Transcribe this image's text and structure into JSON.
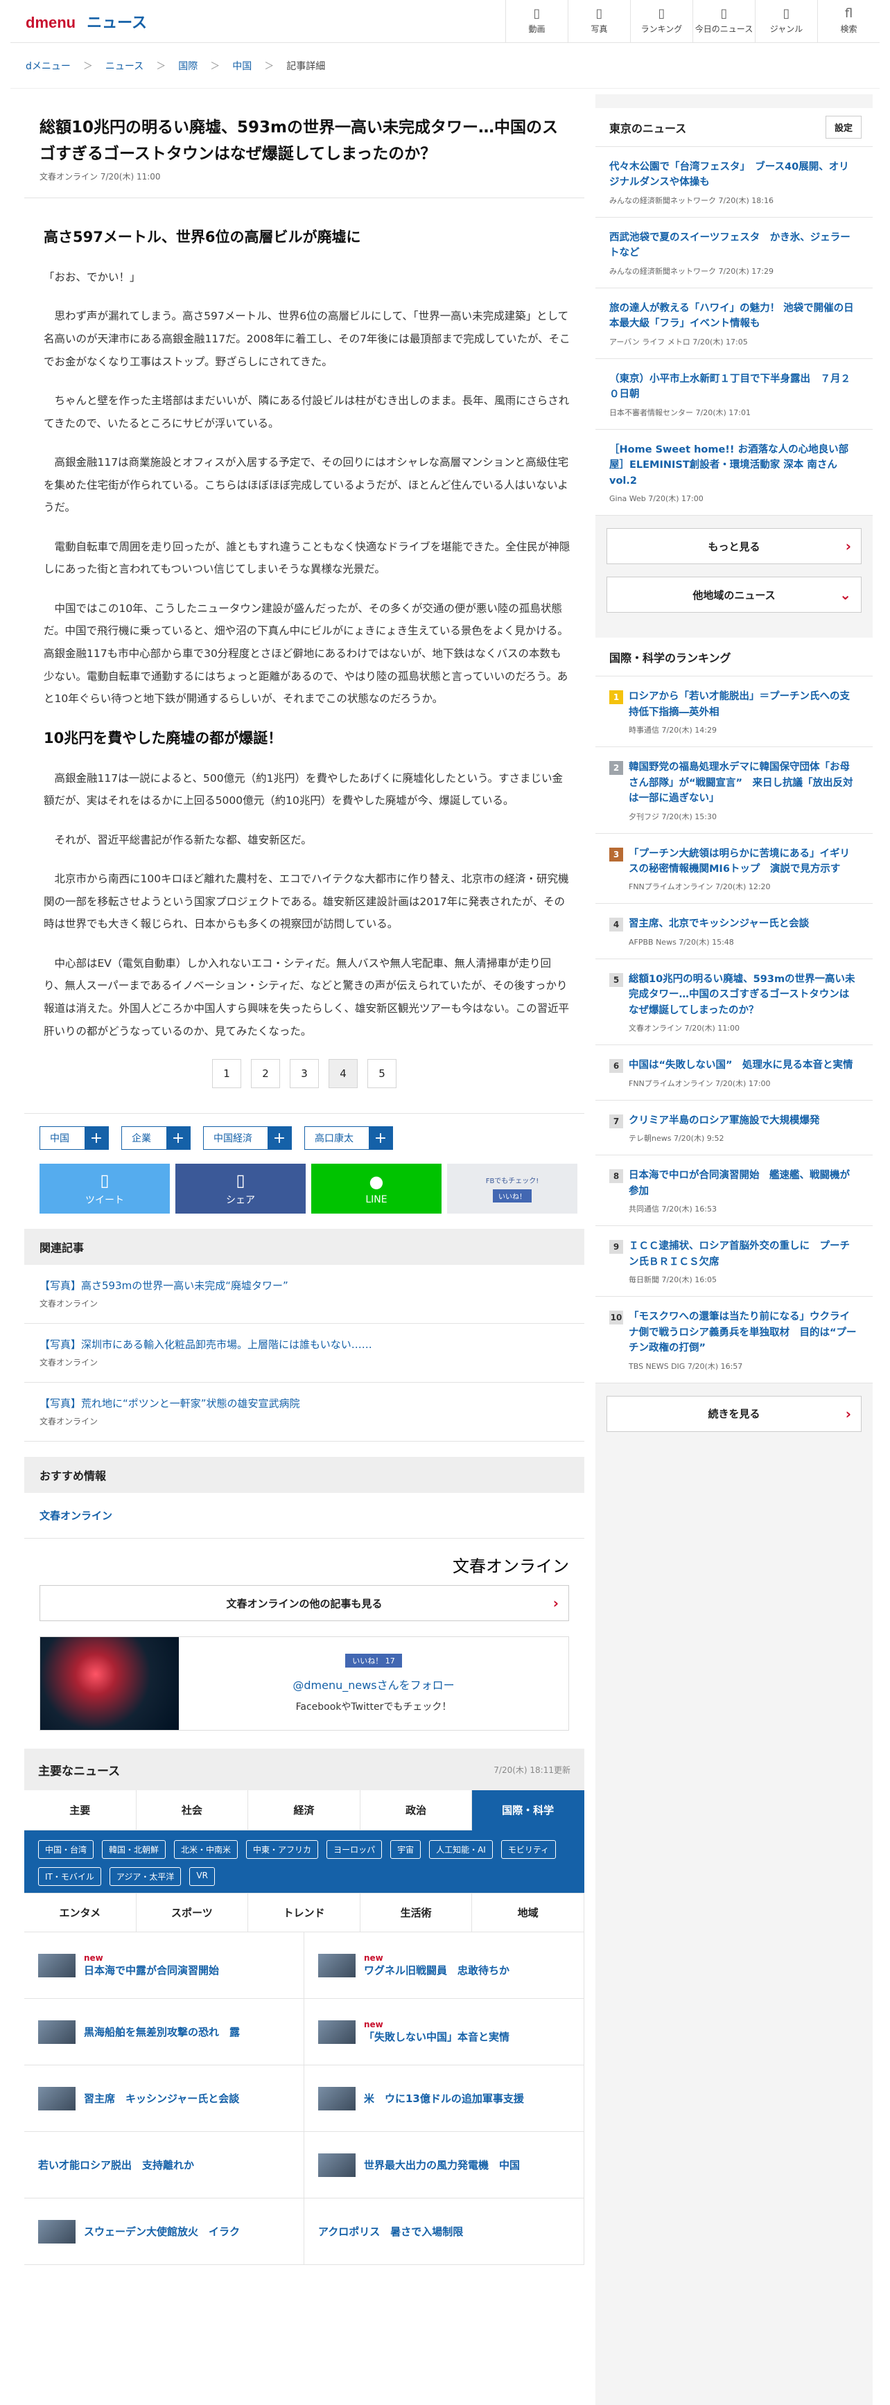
{
  "header": {
    "logo_d": "dmenu",
    "logo_n": "ニュース",
    "nav": [
      {
        "icon": "video-icon",
        "glyph": "▯",
        "label": "動画"
      },
      {
        "icon": "photo-icon",
        "glyph": "▯",
        "label": "写真"
      },
      {
        "icon": "ranking-icon",
        "glyph": "▯",
        "label": "ランキング"
      },
      {
        "icon": "today-icon",
        "glyph": "▯",
        "label": "今日のニュース"
      },
      {
        "icon": "genre-icon",
        "glyph": "▯",
        "label": "ジャンル"
      },
      {
        "icon": "search-icon",
        "glyph": "fl",
        "label": "検索"
      }
    ]
  },
  "breadcrumb": [
    "dメニュー",
    "ニュース",
    "国際",
    "中国",
    "記事詳細"
  ],
  "article": {
    "title": "総額10兆円の明るい廃墟、593mの世界一高い未完成タワー…中国のスゴすぎるゴーストタウンはなぜ爆誕してしまったのか？",
    "meta": "文春オンライン 7/20(木) 11:00",
    "h1": "高さ597メートル、世界6位の高層ビルが廃墟に",
    "p1": "「おお、でかい！」",
    "p2": "　思わず声が漏れてしまう。高さ597メートル、世界6位の高層ビルにして、「世界一高い未完成建築」として名高いのが天津市にある高銀金融117だ。2008年に着工し、その7年後には最頂部まで完成していたが、そこでお金がなくなり工事はストップ。野ざらしにされてきた。",
    "p3": "　ちゃんと壁を作った主塔部はまだいいが、隣にある付設ビルは柱がむき出しのまま。長年、風雨にさらされてきたので、いたるところにサビが浮いている。",
    "p4": "　高銀金融117は商業施設とオフィスが入居する予定で、その回りにはオシャレな高層マンションと高級住宅を集めた住宅街が作られている。こちらはほぼほぼ完成しているようだが、ほとんど住んでいる人はいないようだ。",
    "p5": "　電動自転車で周囲を走り回ったが、誰ともすれ違うこともなく快適なドライブを堪能できた。全住民が神隠しにあった街と言われてもついつい信じてしまいそうな異様な光景だ。",
    "p6": "　中国ではこの10年、こうしたニュータウン建設が盛んだったが、その多くが交通の便が悪い陸の孤島状態だ。中国で飛行機に乗っていると、畑や沼の下真ん中にビルがにょきにょき生えている景色をよく見かける。高銀金融117も市中心部から車で30分程度とさほど僻地にあるわけではないが、地下鉄はなくバスの本数も少ない。電動自転車で通勤するにはちょっと距離があるので、やはり陸の孤島状態と言っていいのだろう。あと10年ぐらい待つと地下鉄が開通するらしいが、それまでこの状態なのだろうか。",
    "h2": "10兆円を費やした廃墟の都が爆誕！",
    "p7": "　高銀金融117は一説によると、500億元（約1兆円）を費やしたあげくに廃墟化したという。すさまじい金額だが、実はそれをはるかに上回る5000億元（約10兆円）を費やした廃墟が今、爆誕している。",
    "p8": "　それが、習近平総書記が作る新たな都、雄安新区だ。",
    "p9": "　北京市から南西に100キロほど離れた農村を、エコでハイテクな大都市に作り替え、北京市の経済・研究機関の一部を移転させようという国家プロジェクトである。雄安新区建設計画は2017年に発表されたが、その時は世界でも大きく報じられ、日本からも多くの視察団が訪問している。",
    "p10": "　中心部はEV（電気自動車）しか入れないエコ・シティだ。無人バスや無人宅配車、無人清掃車が走り回り、無人スーパーまであるイノベーション・シティだ、などと驚きの声が伝えられていたが、その後すっかり報道は消えた。外国人どころか中国人すら興味を失ったらしく、雄安新区観光ツアーも今はない。この習近平肝いりの都がどうなっているのか、見てみたくなった。",
    "pages": [
      "1",
      "2",
      "3",
      "4",
      "5"
    ]
  },
  "tags": [
    "中国",
    "企業",
    "中国経済",
    "高口康太"
  ],
  "share": {
    "tw": "ツイート",
    "fb": "シェア",
    "ln": "LINE",
    "fbc": "FBでもチェック!",
    "fbc_like": "いいね！"
  },
  "related": {
    "title": "関連記事",
    "items": [
      {
        "t": "【写真】高さ593mの世界一高い未完成“廃墟タワー”",
        "s": "文春オンライン"
      },
      {
        "t": "【写真】深圳市にある輸入化粧品卸売市場。上層階には誰もいない……",
        "s": "文春オンライン"
      },
      {
        "t": "【写真】荒れ地に“ポツンと一軒家”状態の雄安宣武病院",
        "s": "文春オンライン"
      }
    ]
  },
  "recommend": {
    "title": "おすすめ情報",
    "source": "文春オンライン",
    "logo": "文春オンライン",
    "more": "文春オンラインの他の記事も見る",
    "like": "いいね！ 17",
    "account": "@dmenu_newsさんをフォロー",
    "sub": "FacebookやTwitterでもチェック！"
  },
  "main_news": {
    "title": "主要なニュース",
    "ts": "7/20(木) 18:11更新",
    "tabs": [
      "主要",
      "社会",
      "経済",
      "政治",
      "国際・科学"
    ],
    "subcats": [
      "中国・台湾",
      "韓国・北朝鮮",
      "北米・中南米",
      "中東・アフリカ",
      "ヨーロッパ",
      "宇宙",
      "人工知能・AI",
      "モビリティ",
      "IT・モバイル",
      "アジア・太平洋",
      "VR"
    ],
    "tabs2": [
      "エンタメ",
      "スポーツ",
      "トレンド",
      "生活術",
      "地域"
    ],
    "items": [
      {
        "t": "日本海で中露が合同演習開始",
        "new": "new"
      },
      {
        "t": "ワグネル旧戦闘員　忠敢待ちか",
        "new": "new"
      },
      {
        "t": "黒海船舶を無差別攻撃の恐れ　露",
        "new": ""
      },
      {
        "t": "「失敗しない中国」本音と実情",
        "new": "new"
      },
      {
        "t": "習主席　キッシンジャー氏と会談",
        "new": ""
      },
      {
        "t": "米　ウに13億ドルの追加軍事支援",
        "new": ""
      },
      {
        "t": "若い才能ロシア脱出　支持離れか",
        "new": ""
      },
      {
        "t": "世界最大出力の風力発電機　中国",
        "new": ""
      },
      {
        "t": "スウェーデン大使館放火　イラク",
        "new": ""
      },
      {
        "t": "アクロポリス　暑さで入場制限",
        "new": ""
      }
    ]
  },
  "sidebar": {
    "tokyo_title": "東京のニュース",
    "setting": "設定",
    "tokyo": [
      {
        "t": "代々木公園で「台湾フェスタ」　ブース40展開、オリジナルダンスや体操も",
        "s": "みんなの経済新聞ネットワーク 7/20(木) 18:16"
      },
      {
        "t": "西武池袋で夏のスイーツフェスタ　かき氷、ジェラートなど",
        "s": "みんなの経済新聞ネットワーク 7/20(木) 17:29"
      },
      {
        "t": "旅の達人が教える「ハワイ」の魅力！ 池袋で開催の日本最大級「フラ」イベント情報も",
        "s": "アーバン ライフ メトロ 7/20(木) 17:05"
      },
      {
        "t": "（東京）小平市上水新町１丁目で下半身露出　７月２０日朝",
        "s": "日本不審者情報センター 7/20(木) 17:01"
      },
      {
        "t": "［Home Sweet home!! お酒落な人の心地良い部屋］ELEMINIST創設者・環境活動家 深本 南さん vol.2",
        "s": "Gina Web 7/20(木) 17:00"
      }
    ],
    "more": "もっと見る",
    "other": "他地域のニュース",
    "rank_title": "国際・科学のランキング",
    "ranking": [
      {
        "n": "1",
        "t": "ロシアから「若い才能脱出」＝プーチン氏への支持低下指摘―英外相",
        "s": "時事通信 7/20(木) 14:29"
      },
      {
        "n": "2",
        "t": "韓国野党の福島処理水デマに韓国保守団体「お母さん部隊」が“戦闘宣言”　来日し抗議「放出反対は一部に過ぎない」",
        "s": "夕刊フジ 7/20(木) 15:30"
      },
      {
        "n": "3",
        "t": "「プーチン大統領は明らかに苦境にある」イギリスの秘密情報機関MI6トップ　演説で見方示す",
        "s": "FNNプライムオンライン 7/20(木) 12:20"
      },
      {
        "n": "4",
        "t": "習主席、北京でキッシンジャー氏と会談",
        "s": "AFPBB News 7/20(木) 15:48"
      },
      {
        "n": "5",
        "t": "総額10兆円の明るい廃墟、593mの世界一高い未完成タワー…中国のスゴすぎるゴーストタウンはなぜ爆誕してしまったのか？",
        "s": "文春オンライン 7/20(木) 11:00"
      },
      {
        "n": "6",
        "t": "中国は“失敗しない国”　処理水に見る本音と実情",
        "s": "FNNプライムオンライン 7/20(木) 17:00"
      },
      {
        "n": "7",
        "t": "クリミア半島のロシア軍施設で大規模爆発",
        "s": "テレ朝news 7/20(木) 9:52"
      },
      {
        "n": "8",
        "t": "日本海で中ロが合同演習開始　艦速艦、戦闘機が参加",
        "s": "共同通信 7/20(木) 16:53"
      },
      {
        "n": "9",
        "t": "ＩＣＣ逮捕状、ロシア首脳外交の重しに　プーチン氏ＢＲＩＣＳ欠席",
        "s": "毎日新聞 7/20(木) 16:05"
      },
      {
        "n": "10",
        "t": "「モスクワへの還筆は当たり前になる」ウクライナ側で戦うロシア義勇兵を単独取材　目的は“プーチン政権の打倒”",
        "s": "TBS NEWS DIG 7/20(木) 16:57"
      }
    ],
    "rank_more": "続きを見る"
  },
  "colors": {
    "brand_blue": "#1561a8",
    "brand_red": "#c8102e"
  }
}
